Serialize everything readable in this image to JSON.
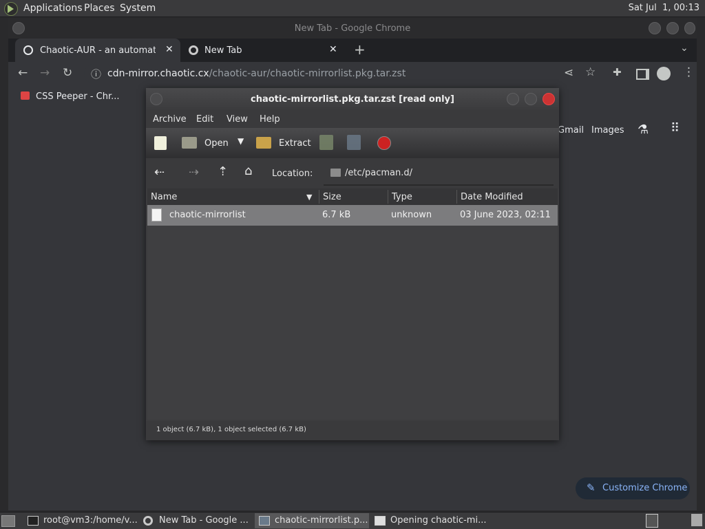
{
  "top_panel": {
    "menus": [
      "Applications",
      "Places",
      "System"
    ],
    "clock": "Sat Jul  1, 00:13"
  },
  "chrome": {
    "window_title": "New Tab - Google Chrome",
    "tabs": [
      {
        "label": "Chaotic-AUR - an automated b",
        "icon": "globe-icon"
      },
      {
        "label": "New Tab",
        "icon": "chrome-icon"
      }
    ],
    "new_tab_symbol": "+",
    "url_domain": "cdn-mirror.chaotic.cx",
    "url_path": "/chaotic-aur/chaotic-mirrorlist.pkg.tar.zst",
    "bookmarks": [
      {
        "label": "CSS Peeper - Chr..."
      }
    ],
    "ntp": {
      "gmail": "Gmail",
      "images": "Images",
      "customize": "Customize Chrome"
    },
    "accent": "#8ab4f8"
  },
  "file_roller": {
    "title": "chaotic-mirrorlist.pkg.tar.zst [read only]",
    "menus": [
      "Archive",
      "Edit",
      "View",
      "Help"
    ],
    "toolbar": {
      "open": "Open",
      "extract": "Extract"
    },
    "location_label": "Location:",
    "location_path": "/etc/pacman.d/",
    "columns": [
      "Name",
      "Size",
      "Type",
      "Date Modified"
    ],
    "rows": [
      {
        "name": "chaotic-mirrorlist",
        "size": "6.7 kB",
        "type": "unknown",
        "modified": "03 June 2023, 02:11"
      }
    ],
    "status": "1 object (6.7 kB), 1 object selected (6.7 kB)"
  },
  "taskbar": {
    "items": [
      {
        "label": "root@vm3:/home/v..."
      },
      {
        "label": "New Tab - Google ..."
      },
      {
        "label": "chaotic-mirrorlist.p..."
      },
      {
        "label": "Opening chaotic-mi..."
      }
    ]
  }
}
